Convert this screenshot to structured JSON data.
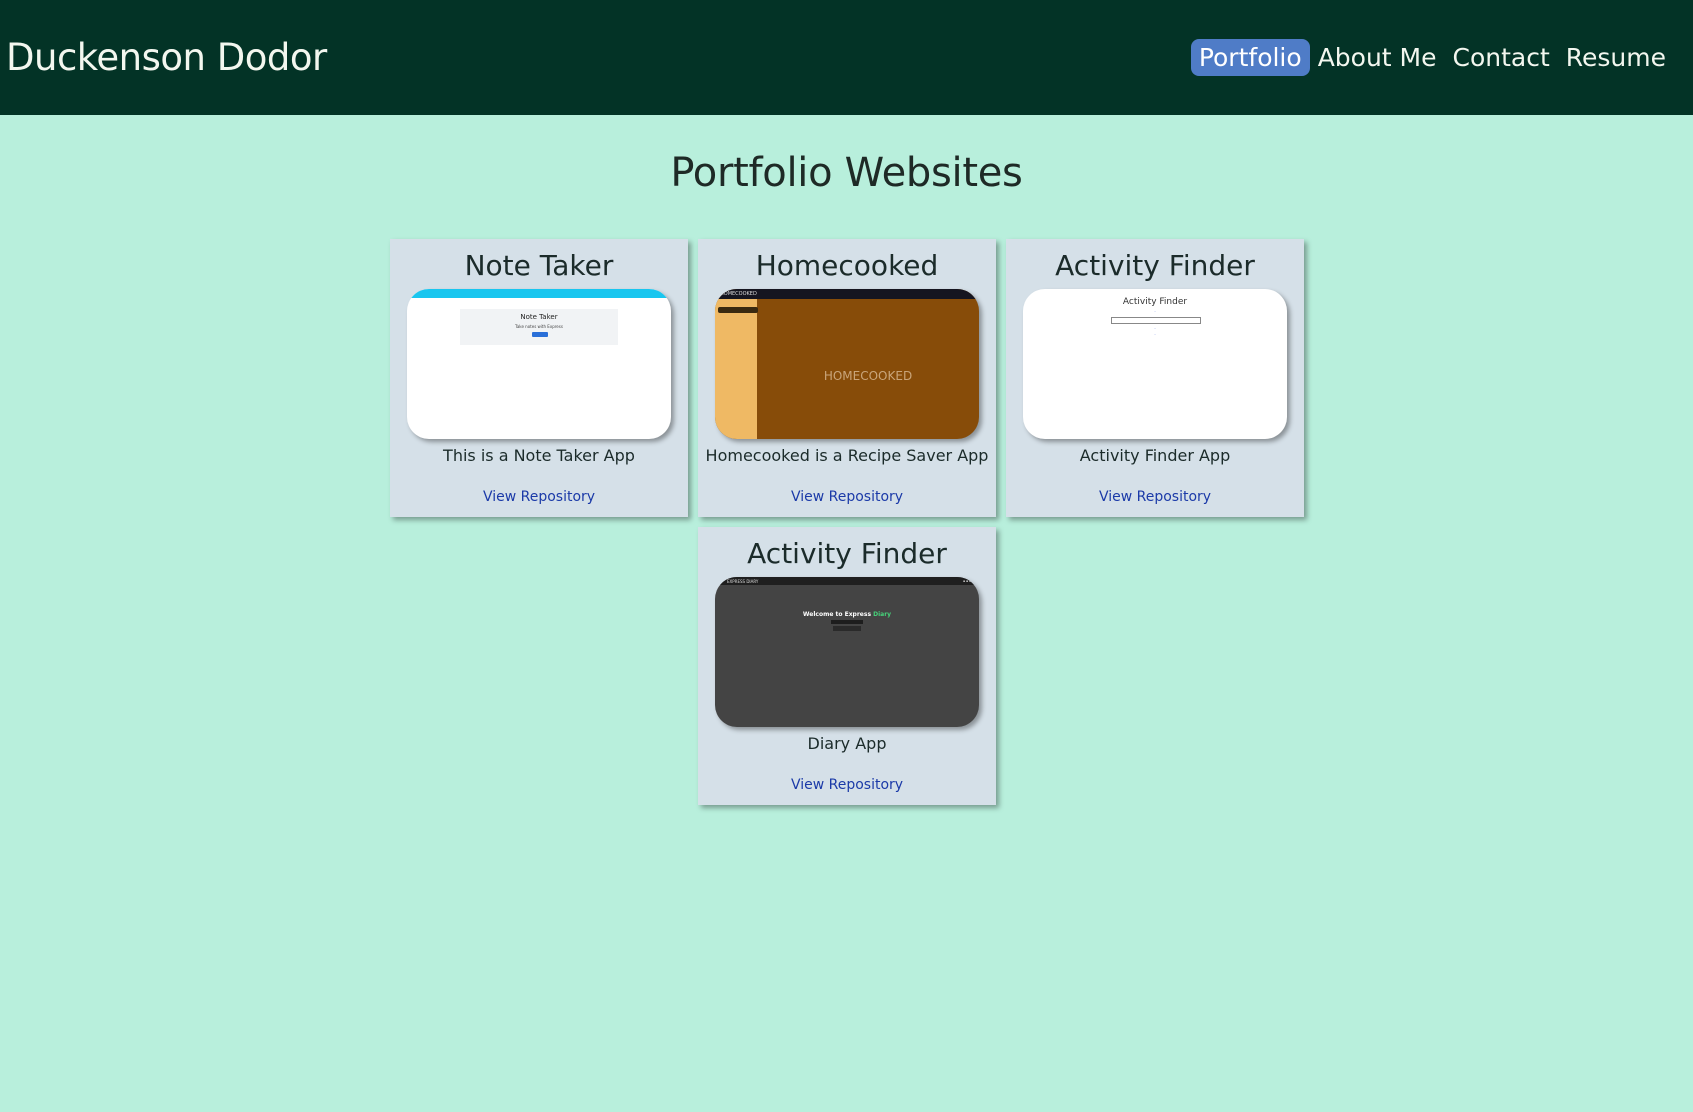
{
  "header": {
    "brand": "Duckenson Dodor",
    "nav": [
      {
        "label": "Portfolio",
        "active": true
      },
      {
        "label": "About Me",
        "active": false
      },
      {
        "label": "Contact",
        "active": false
      },
      {
        "label": "Resume",
        "active": false
      }
    ]
  },
  "main": {
    "title": "Portfolio Websites",
    "cards": [
      {
        "title": "Note Taker",
        "description": "This is a Note Taker App",
        "link": "View Repository",
        "thumbnail": {
          "title": "Note Taker",
          "subtitle": "Take notes with Express"
        }
      },
      {
        "title": "Homecooked",
        "description": "Homecooked is a Recipe Saver App",
        "link": "View Repository",
        "thumbnail": {
          "header": "HOMECOOKED",
          "brand": "HOMECOOKED"
        }
      },
      {
        "title": "Activity Finder",
        "description": "Activity Finder App",
        "link": "View Repository",
        "thumbnail": {
          "title": "Activity Finder"
        }
      },
      {
        "title": "Activity Finder",
        "description": "Diary App",
        "link": "View Repository",
        "thumbnail": {
          "logo": "EXPRESS DIARY",
          "welcome": "Welcome to Express",
          "welcome_accent": "Diary"
        }
      }
    ]
  },
  "colors": {
    "background": "#b8efdc",
    "navbar": "#033326",
    "active_nav": "#4f7cc7",
    "card": "#d5e0e8",
    "link": "#1b3aa8"
  }
}
